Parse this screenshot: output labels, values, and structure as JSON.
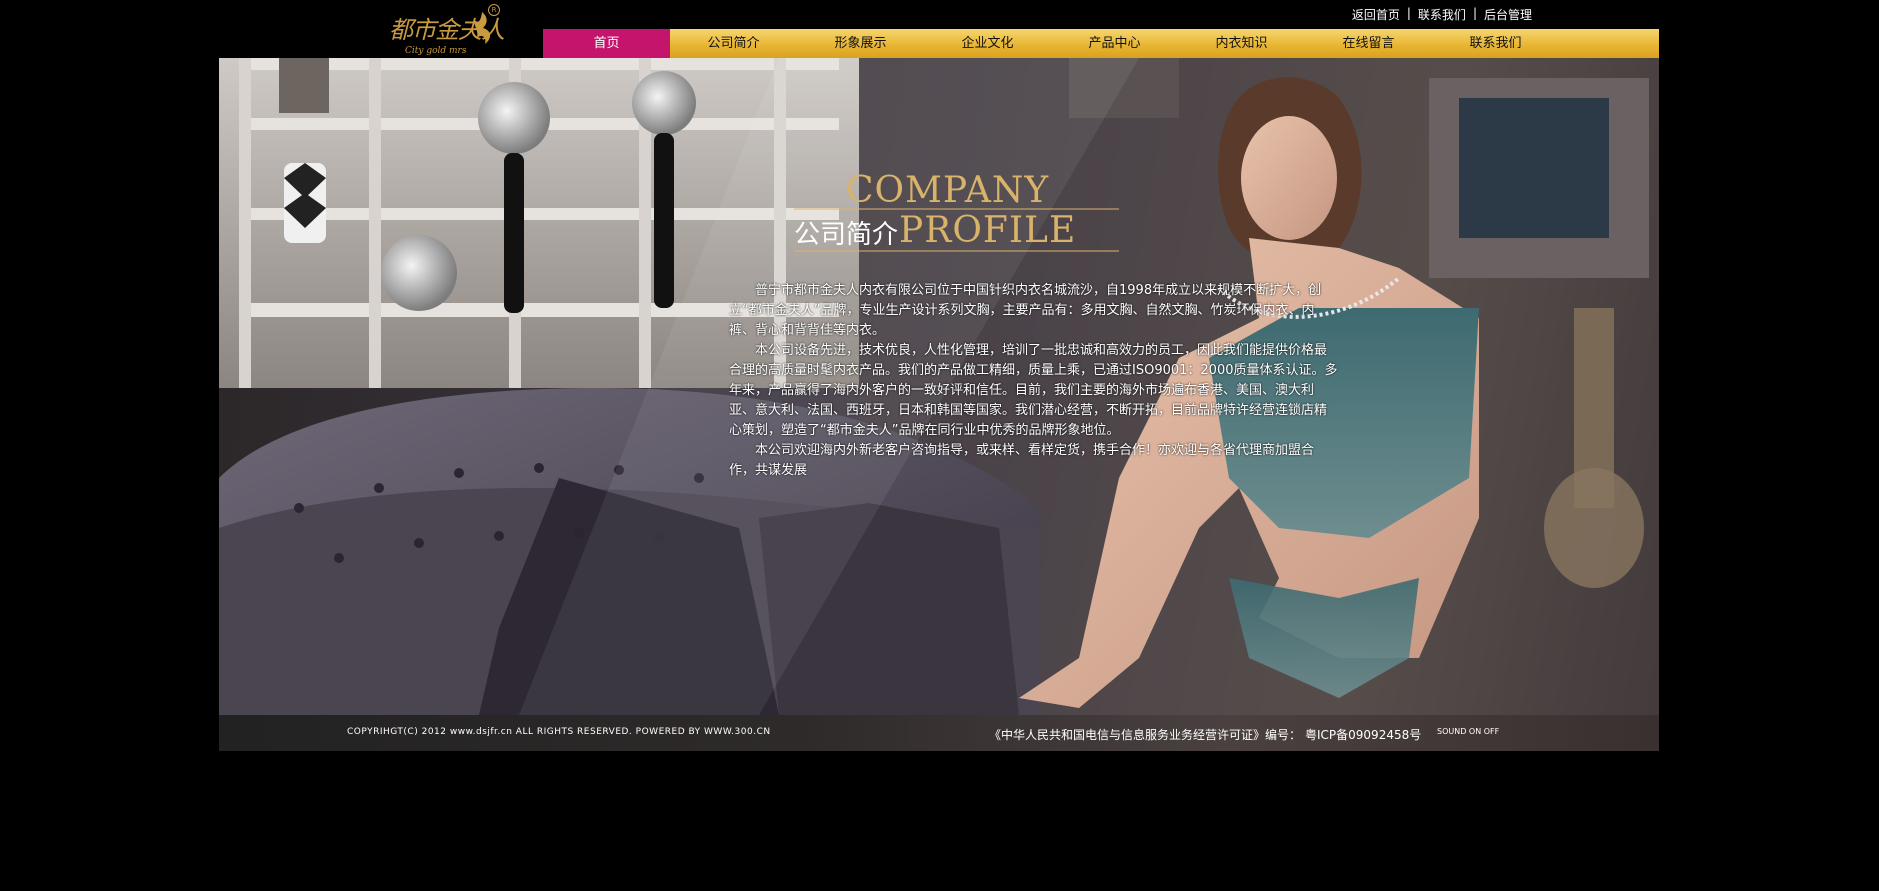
{
  "logo": {
    "brand_text": "都市金夫人",
    "sub_text": "City gold mrs",
    "registered_mark": "R"
  },
  "top_links": [
    {
      "label": "返回首页"
    },
    {
      "label": "联系我们"
    },
    {
      "label": "后台管理"
    }
  ],
  "top_links_separator": "|",
  "nav": {
    "active_index": 0,
    "items": [
      {
        "label": "首页"
      },
      {
        "label": "公司简介"
      },
      {
        "label": "形象展示"
      },
      {
        "label": "企业文化"
      },
      {
        "label": "产品中心"
      },
      {
        "label": "内衣知识"
      },
      {
        "label": "在线留言"
      },
      {
        "label": "联系我们"
      }
    ]
  },
  "hero": {
    "heading_en_top": "COMPANY",
    "heading_cn": "公司简介",
    "heading_en_bottom": "PROFILE",
    "paragraphs": [
      "普宁市都市金夫人内衣有限公司位于中国针织内衣名城流沙，自1998年成立以来规模不断扩大，创立“都市金夫人”品牌，专业生产设计系列文胸，主要产品有：多用文胸、自然文胸、竹炭环保内衣、内裤、背心和背背佳等内衣。",
      "本公司设备先进，技术优良，人性化管理，培训了一批忠诚和高效力的员工，因此我们能提供价格最合理的高质量时髦内衣产品。我们的产品做工精细，质量上乘，已通过ISO9001：2000质量体系认证。多年来，产品赢得了海内外客户的一致好评和信任。目前，我们主要的海外市场遍布香港、美国、澳大利亚、意大利、法国、西班牙，日本和韩国等国家。我们潜心经营，不断开拓，目前品牌特许经营连锁店精心策划，塑造了“都市金夫人”品牌在同行业中优秀的品牌形象地位。",
      "本公司欢迎海内外新老客户咨询指导，或来样、看样定货，携手合作！亦欢迎与各省代理商加盟合作，共谋发展"
    ]
  },
  "footer": {
    "copyright": "COPYRIHGT(C) 2012 www.dsjfr.cn ALL RIGHTS RESERVED. POWERED BY WWW.300.CN",
    "license_text": "《中华人民共和国电信与信息服务业务经营许可证》编号：",
    "icp_number": "粤ICP备09092458号",
    "sound_label": "SOUND ON OFF"
  },
  "colors": {
    "nav_gold": "#e8b634",
    "nav_active": "#c4146c",
    "heading_gold": "#d9b36a",
    "background": "#000000"
  }
}
